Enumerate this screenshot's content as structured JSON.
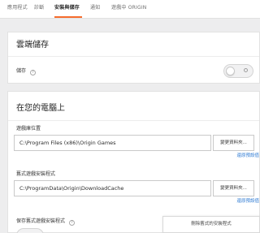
{
  "tabs": [
    {
      "label": "應用程式",
      "active": false
    },
    {
      "label": "診斷",
      "active": false
    },
    {
      "label": "安裝與儲存",
      "active": true
    },
    {
      "label": "通知",
      "active": false
    },
    {
      "label": "遊戲中 ORIGIN",
      "active": false
    }
  ],
  "cloud": {
    "title": "雲端儲存",
    "storage_label": "儲存",
    "storage_toggle": "off"
  },
  "local": {
    "title": "在您的電腦上",
    "library_label": "遊戲庫位置",
    "library_path": "C:\\Program Files (x86)\\Origin Games",
    "library_browse": "變更資料夾...",
    "library_reset": "還原預設值",
    "installer_label": "舊式遊戲安裝程式",
    "installer_path": "C:\\ProgramData\\Origin\\DownloadCache",
    "installer_browse": "變更資料夾...",
    "installer_reset": "還原預設值",
    "keep_installers_label": "保存舊式遊戲安裝程式"
  },
  "tooltip": {
    "text": "刪除舊式的安裝程式"
  },
  "colors": {
    "accent": "#f56c2d",
    "link": "#2f7bd3",
    "background": "#ededee",
    "card": "#ffffff"
  },
  "icons": {
    "help": "question-circle-icon"
  }
}
